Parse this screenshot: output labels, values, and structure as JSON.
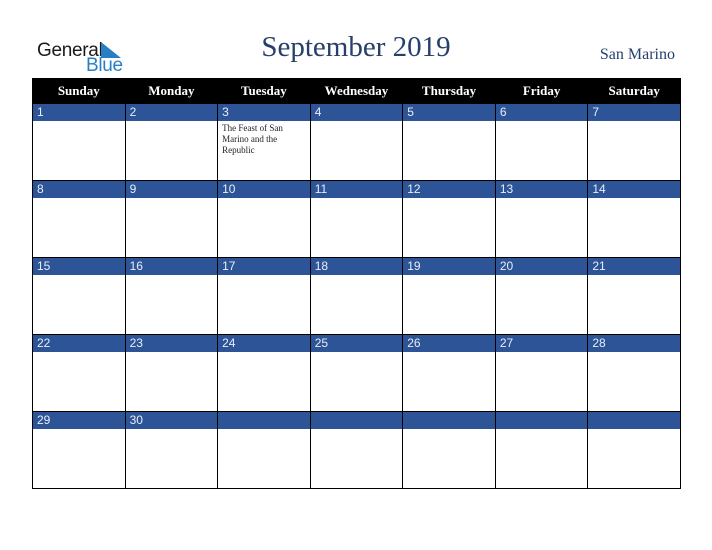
{
  "logo": {
    "general": "General",
    "blue": "Blue",
    "colors": {
      "text": "#1a1a1a",
      "accent": "#2a7fc4"
    }
  },
  "header": {
    "title": "September 2019",
    "country": "San Marino"
  },
  "weekdays": [
    "Sunday",
    "Monday",
    "Tuesday",
    "Wednesday",
    "Thursday",
    "Friday",
    "Saturday"
  ],
  "colors": {
    "header_bg": "#000000",
    "day_band": "#2d5496",
    "title": "#27406b"
  },
  "weeks": [
    [
      {
        "day": "1",
        "event": ""
      },
      {
        "day": "2",
        "event": ""
      },
      {
        "day": "3",
        "event": "The Feast of San Marino and the Republic"
      },
      {
        "day": "4",
        "event": ""
      },
      {
        "day": "5",
        "event": ""
      },
      {
        "day": "6",
        "event": ""
      },
      {
        "day": "7",
        "event": ""
      }
    ],
    [
      {
        "day": "8",
        "event": ""
      },
      {
        "day": "9",
        "event": ""
      },
      {
        "day": "10",
        "event": ""
      },
      {
        "day": "11",
        "event": ""
      },
      {
        "day": "12",
        "event": ""
      },
      {
        "day": "13",
        "event": ""
      },
      {
        "day": "14",
        "event": ""
      }
    ],
    [
      {
        "day": "15",
        "event": ""
      },
      {
        "day": "16",
        "event": ""
      },
      {
        "day": "17",
        "event": ""
      },
      {
        "day": "18",
        "event": ""
      },
      {
        "day": "19",
        "event": ""
      },
      {
        "day": "20",
        "event": ""
      },
      {
        "day": "21",
        "event": ""
      }
    ],
    [
      {
        "day": "22",
        "event": ""
      },
      {
        "day": "23",
        "event": ""
      },
      {
        "day": "24",
        "event": ""
      },
      {
        "day": "25",
        "event": ""
      },
      {
        "day": "26",
        "event": ""
      },
      {
        "day": "27",
        "event": ""
      },
      {
        "day": "28",
        "event": ""
      }
    ],
    [
      {
        "day": "29",
        "event": ""
      },
      {
        "day": "30",
        "event": ""
      },
      {
        "day": "",
        "event": ""
      },
      {
        "day": "",
        "event": ""
      },
      {
        "day": "",
        "event": ""
      },
      {
        "day": "",
        "event": ""
      },
      {
        "day": "",
        "event": ""
      }
    ]
  ]
}
